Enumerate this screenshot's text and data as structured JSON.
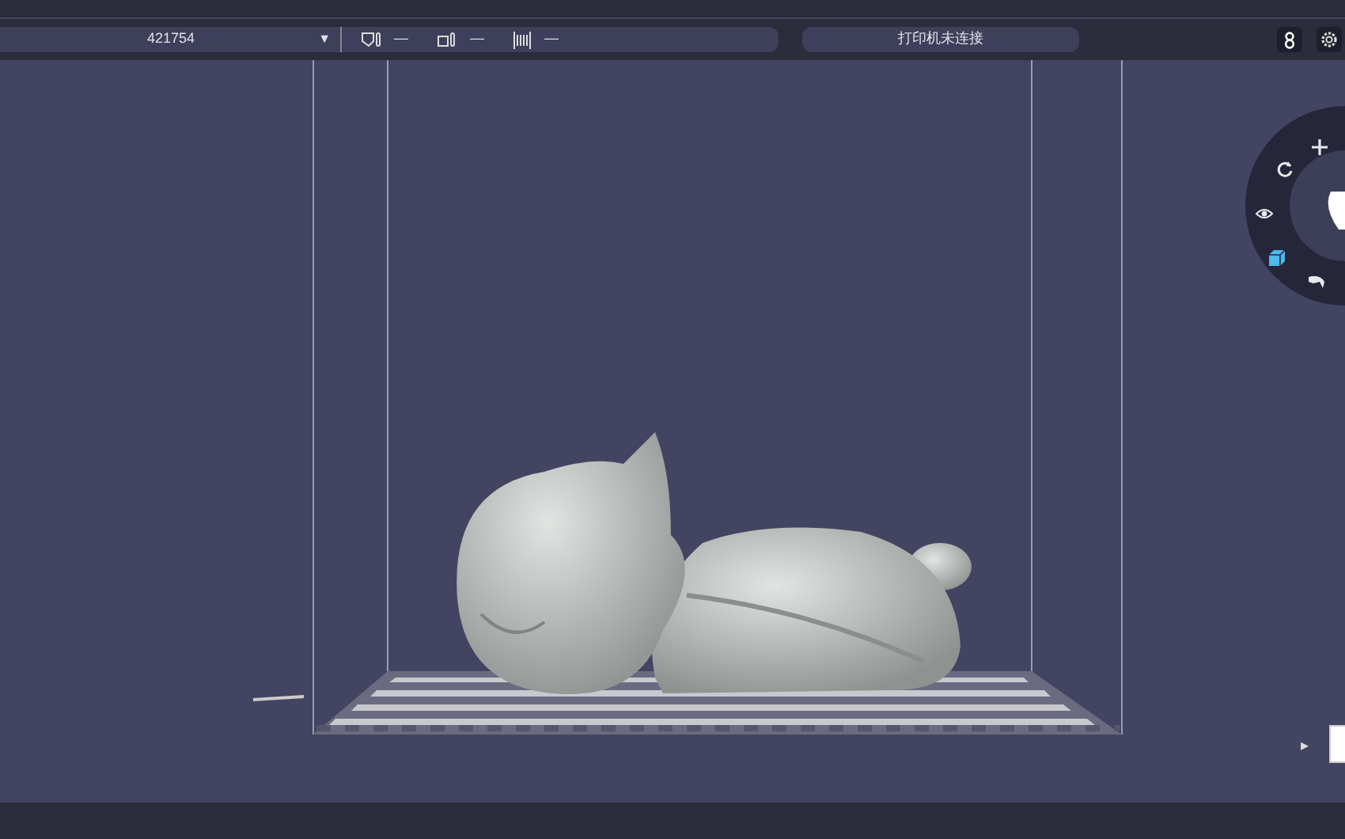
{
  "toolbar": {
    "printer_select": {
      "value": "421754",
      "caret": "▼"
    },
    "readings": [
      {
        "kind": "nozzle",
        "value": "—"
      },
      {
        "kind": "bed",
        "value": "—"
      },
      {
        "kind": "fan",
        "value": "—"
      }
    ],
    "status": "打印机未连接"
  },
  "radial_menu": {
    "tools": [
      {
        "kind": "move",
        "selected": false
      },
      {
        "kind": "rotate",
        "selected": false
      },
      {
        "kind": "view",
        "selected": false
      },
      {
        "kind": "cube",
        "selected": true
      },
      {
        "kind": "scale",
        "selected": false
      }
    ]
  },
  "side_toggle": "▸"
}
